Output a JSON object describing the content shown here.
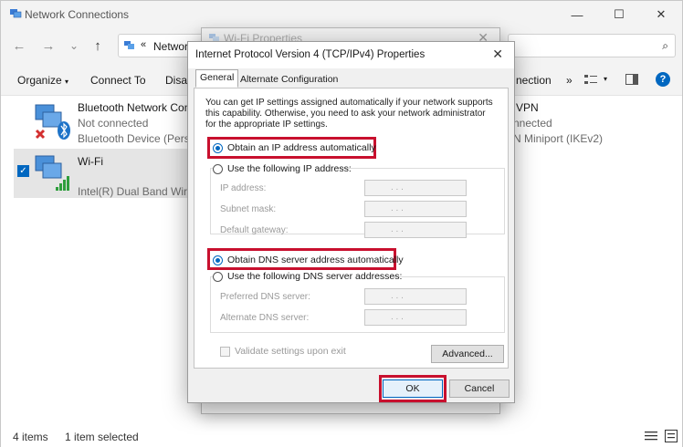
{
  "explorer": {
    "title": "Network Connections",
    "breadcrumb_sep": "«",
    "breadcrumb": "Network",
    "window_controls": {
      "minimize": "—",
      "maximize": "☐",
      "close": "✕"
    },
    "nav": {
      "back": "←",
      "forward": "→",
      "chevron": "⌄",
      "up": "↑"
    },
    "search_glyph": "⌕",
    "toolbar": {
      "organize": "Organize",
      "connect_to": "Connect To",
      "disable": "Disab",
      "right_fragment": "nection",
      "more": "»",
      "dropdown_glyph": "▾",
      "help": "?"
    },
    "items": [
      {
        "name": "Bluetooth Network Conne",
        "status": "Not connected",
        "device": "Bluetooth Device (Persona"
      },
      {
        "name": "Wi-Fi",
        "status": "",
        "device": "Intel(R) Dual Band Wireles"
      },
      {
        "name": "VPN",
        "status": "nnected",
        "device": "N Miniport (IKEv2)"
      }
    ],
    "status": {
      "count": "4 items",
      "selected": "1 item selected"
    }
  },
  "wifi_properties": {
    "title": "Wi-Fi Properties",
    "close": "✕"
  },
  "dialog": {
    "title": "Internet Protocol Version 4 (TCP/IPv4) Properties",
    "close": "✕",
    "tabs": [
      "General",
      "Alternate Configuration"
    ],
    "description": "You can get IP settings assigned automatically if your network supports this capability. Otherwise, you need to ask your network administrator for the appropriate IP settings.",
    "ip": {
      "auto_label": "Obtain an IP address automatically",
      "manual_label": "Use the following IP address:",
      "auto_selected": true,
      "fields": [
        {
          "label": "IP address:",
          "value": ".   .   ."
        },
        {
          "label": "Subnet mask:",
          "value": ".   .   ."
        },
        {
          "label": "Default gateway:",
          "value": ".   .   ."
        }
      ]
    },
    "dns": {
      "auto_label": "Obtain DNS server address automatically",
      "manual_label": "Use the following DNS server addresses:",
      "auto_selected": true,
      "fields": [
        {
          "label": "Preferred DNS server:",
          "value": ".   .   ."
        },
        {
          "label": "Alternate DNS server:",
          "value": ".   .   ."
        }
      ]
    },
    "validate_label": "Validate settings upon exit",
    "advanced_label": "Advanced...",
    "ok_label": "OK",
    "cancel_label": "Cancel"
  },
  "colors": {
    "accent": "#0067c0",
    "highlight_box": "#c8102e",
    "selection": "#e5e5e5"
  }
}
